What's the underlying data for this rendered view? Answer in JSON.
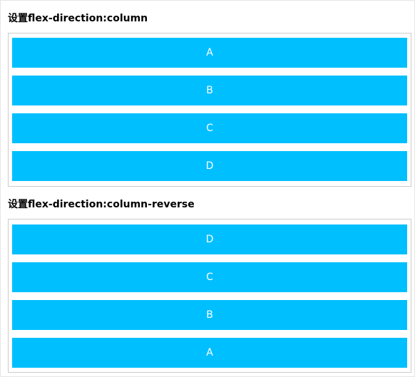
{
  "sections": [
    {
      "title": "设置flex-direction:column",
      "items": [
        "A",
        "B",
        "C",
        "D"
      ]
    },
    {
      "title": "设置flex-direction:column-reverse",
      "items": [
        "A",
        "B",
        "C",
        "D"
      ]
    }
  ],
  "colors": {
    "item_background": "#00bfff",
    "item_text": "#ffffff",
    "container_border": "#cccccc"
  }
}
